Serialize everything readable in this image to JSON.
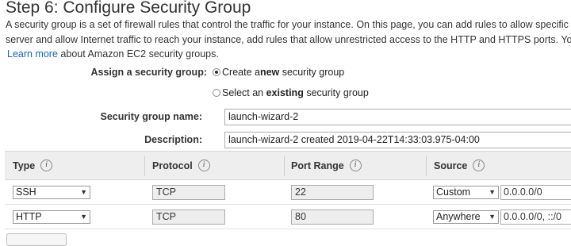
{
  "page": {
    "title": "Step 6: Configure Security Group",
    "description_line1": "A security group is a set of firewall rules that control the traffic for your instance. On this page, you can add rules to allow specific tra",
    "description_line2": "server and allow Internet traffic to reach your instance, add rules that allow unrestricted access to the HTTP and HTTPS ports. You c",
    "learn_more_link": "Learn more",
    "learn_more_suffix": "about Amazon EC2 security groups."
  },
  "assign": {
    "label": "Assign a security group:",
    "options": [
      {
        "pre": "Create a ",
        "bold": "new",
        "post": " security group",
        "selected": true
      },
      {
        "pre": "Select an ",
        "bold": "existing",
        "post": " security group",
        "selected": false
      }
    ]
  },
  "fields": {
    "name_label": "Security group name:",
    "name_value": "launch-wizard-2",
    "description_label": "Description:",
    "description_value": "launch-wizard-2 created 2019-04-22T14:33:03.975-04:00"
  },
  "table": {
    "headers": [
      "Type",
      "Protocol",
      "Port Range",
      "Source"
    ],
    "info_icon": "i",
    "rows": [
      {
        "type": "SSH",
        "protocol": "TCP",
        "port": "22",
        "source": "Custom",
        "cidr": "0.0.0.0/0"
      },
      {
        "type": "HTTP",
        "protocol": "TCP",
        "port": "80",
        "source": "Anywhere",
        "cidr": "0.0.0.0/0, ::/0"
      }
    ]
  }
}
